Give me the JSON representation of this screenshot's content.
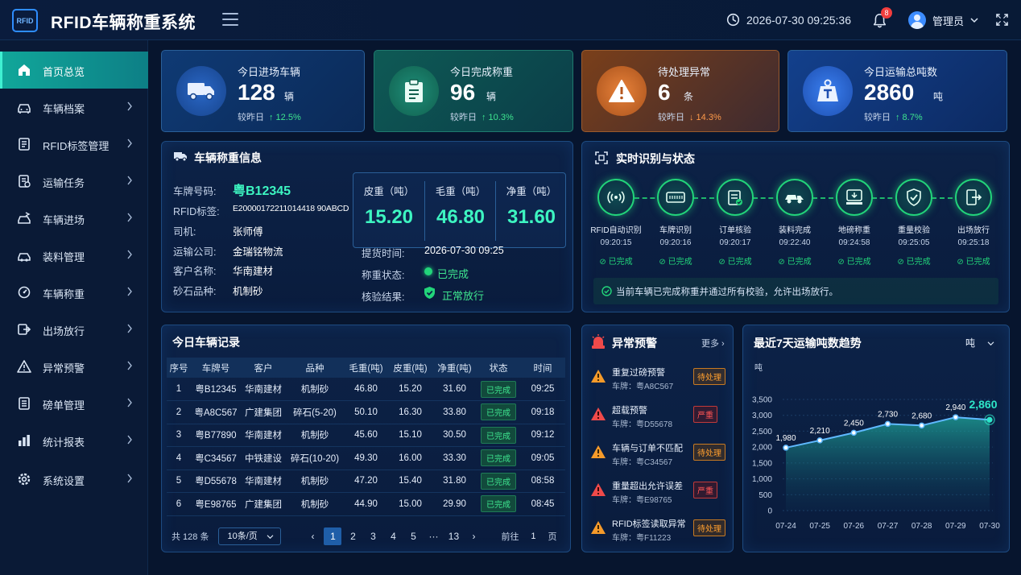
{
  "header": {
    "logo_text": "RFID",
    "title": "RFID车辆称重系统",
    "datetime": "2026-07-30 09:25:36",
    "notification_count": "8",
    "user_name": "管理员"
  },
  "sidebar": {
    "items": [
      {
        "label": "首页总览",
        "icon": "home-icon",
        "active": true
      },
      {
        "label": "车辆档案",
        "icon": "car-icon"
      },
      {
        "label": "RFID标签管理",
        "icon": "tag-list-icon"
      },
      {
        "label": "运输任务",
        "icon": "task-icon"
      },
      {
        "label": "车辆进场",
        "icon": "car-entry-icon"
      },
      {
        "label": "装料管理",
        "icon": "loading-icon"
      },
      {
        "label": "车辆称重",
        "icon": "weigh-icon"
      },
      {
        "label": "出场放行",
        "icon": "exit-icon"
      },
      {
        "label": "异常预警",
        "icon": "warning-icon"
      },
      {
        "label": "磅单管理",
        "icon": "ticket-icon"
      },
      {
        "label": "统计报表",
        "icon": "report-icon"
      },
      {
        "label": "系统设置",
        "icon": "settings-icon"
      }
    ]
  },
  "stats": [
    {
      "title": "今日进场车辆",
      "value": "128",
      "unit": "辆",
      "compare_label": "较昨日",
      "trend": "↑ 12.5%",
      "direction": "up",
      "icon": "truck-icon",
      "accent": "#1f6fd1"
    },
    {
      "title": "今日完成称重",
      "value": "96",
      "unit": "辆",
      "compare_label": "较昨日",
      "trend": "↑ 10.3%",
      "direction": "up",
      "icon": "clipboard-icon",
      "accent": "#14a07e"
    },
    {
      "title": "待处理异常",
      "value": "6",
      "unit": "条",
      "compare_label": "较昨日",
      "trend": "↓ 14.3%",
      "direction": "down",
      "icon": "alert-icon",
      "accent": "#d8722a"
    },
    {
      "title": "今日运输总吨数",
      "value": "2860",
      "unit": "吨",
      "compare_label": "较昨日",
      "trend": "↑ 8.7%",
      "direction": "up",
      "icon": "weight-icon",
      "accent": "#2b6fe0"
    }
  ],
  "vehicle_info": {
    "title": "车辆称重信息",
    "fields": [
      {
        "label": "车牌号码:",
        "value": "粤B12345"
      },
      {
        "label": "RFID标签:",
        "value": "E20000172211014418 90ABCD"
      },
      {
        "label": "司机:",
        "value": "张师傅"
      },
      {
        "label": "运输公司:",
        "value": "金瑞铭物流"
      },
      {
        "label": "客户名称:",
        "value": "华南建材"
      },
      {
        "label": "砂石品种:",
        "value": "机制砂"
      }
    ],
    "weights": [
      {
        "label": "皮重（吨）",
        "value": "15.20"
      },
      {
        "label": "毛重（吨）",
        "value": "46.80"
      },
      {
        "label": "净重（吨）",
        "value": "31.60"
      }
    ],
    "pickup_label": "提货时间:",
    "pickup_value": "2026-07-30 09:25",
    "status_label": "称重状态:",
    "status_value": "已完成",
    "check_label": "核验结果:",
    "check_value": "正常放行"
  },
  "status_flow": {
    "title": "实时识别与状态",
    "steps": [
      {
        "label": "RFID自动识别",
        "time": "09:20:15",
        "state": "已完成",
        "icon": "rfid-signal-icon"
      },
      {
        "label": "车牌识别",
        "time": "09:20:16",
        "state": "已完成",
        "icon": "plate-icon"
      },
      {
        "label": "订单核验",
        "time": "09:20:17",
        "state": "已完成",
        "icon": "order-check-icon"
      },
      {
        "label": "装料完成",
        "time": "09:22:40",
        "state": "已完成",
        "icon": "loader-truck-icon"
      },
      {
        "label": "地磅称重",
        "time": "09:24:58",
        "state": "已完成",
        "icon": "scale-icon"
      },
      {
        "label": "重量校验",
        "time": "09:25:05",
        "state": "已完成",
        "icon": "shield-check-icon"
      },
      {
        "label": "出场放行",
        "time": "09:25:18",
        "state": "已完成",
        "icon": "exit-door-icon"
      }
    ],
    "message": "当前车辆已完成称重并通过所有校验，允许出场放行。"
  },
  "records": {
    "title": "今日车辆记录",
    "columns": [
      "序号",
      "车牌号",
      "客户",
      "品种",
      "毛重(吨)",
      "皮重(吨)",
      "净重(吨)",
      "状态",
      "时间"
    ],
    "rows": [
      [
        "1",
        "粤B12345",
        "华南建材",
        "机制砂",
        "46.80",
        "15.20",
        "31.60",
        "已完成",
        "09:25"
      ],
      [
        "2",
        "粤A8C567",
        "广建集团",
        "碎石(5-20)",
        "50.10",
        "16.30",
        "33.80",
        "已完成",
        "09:18"
      ],
      [
        "3",
        "粤B77890",
        "华南建材",
        "机制砂",
        "45.60",
        "15.10",
        "30.50",
        "已完成",
        "09:12"
      ],
      [
        "4",
        "粤C34567",
        "中铁建设",
        "碎石(10-20)",
        "49.30",
        "16.00",
        "33.30",
        "已完成",
        "09:05"
      ],
      [
        "5",
        "粤D55678",
        "华南建材",
        "机制砂",
        "47.20",
        "15.40",
        "31.80",
        "已完成",
        "08:58"
      ],
      [
        "6",
        "粤E98765",
        "广建集团",
        "机制砂",
        "44.90",
        "15.00",
        "29.90",
        "已完成",
        "08:45"
      ]
    ],
    "pager": {
      "total": "共 128 条",
      "page_size": "10条/页",
      "pages": [
        "1",
        "2",
        "3",
        "4",
        "5",
        "···",
        "13"
      ],
      "current": "1",
      "goto_label": "前往",
      "goto_value": "1",
      "page_unit": "页"
    }
  },
  "alerts": {
    "title": "异常预警",
    "more": "更多",
    "items": [
      {
        "title": "重复过磅预警",
        "plate": "车牌：粤A8C567",
        "tag": "待处理",
        "level": "pending"
      },
      {
        "title": "超载预警",
        "plate": "车牌：粤D55678",
        "tag": "严重",
        "level": "severe"
      },
      {
        "title": "车辆与订单不匹配",
        "plate": "车牌：粤C34567",
        "tag": "待处理",
        "level": "pending"
      },
      {
        "title": "重量超出允许误差",
        "plate": "车牌：粤E98765",
        "tag": "严重",
        "level": "severe"
      },
      {
        "title": "RFID标签读取异常",
        "plate": "车牌：粤F11223",
        "tag": "待处理",
        "level": "pending"
      }
    ]
  },
  "trend": {
    "title": "最近7天运输吨数趋势",
    "unit_select": "吨"
  },
  "chart_data": {
    "type": "area",
    "title": "最近7天运输吨数趋势",
    "ylabel": "吨",
    "categories": [
      "07-24",
      "07-25",
      "07-26",
      "07-27",
      "07-28",
      "07-29",
      "07-30"
    ],
    "values": [
      1980,
      2210,
      2450,
      2730,
      2680,
      2940,
      2860
    ],
    "data_labels": [
      "1,980",
      "2,210",
      "2,450",
      "2,730",
      "2,680",
      "2,940",
      "2,860"
    ],
    "ylim": [
      0,
      3500
    ],
    "yticks": [
      "0",
      "500",
      "1,000",
      "1,500",
      "2,000",
      "2,500",
      "3,000",
      "3,500"
    ],
    "grid": true,
    "color": "#2ee6c8"
  }
}
